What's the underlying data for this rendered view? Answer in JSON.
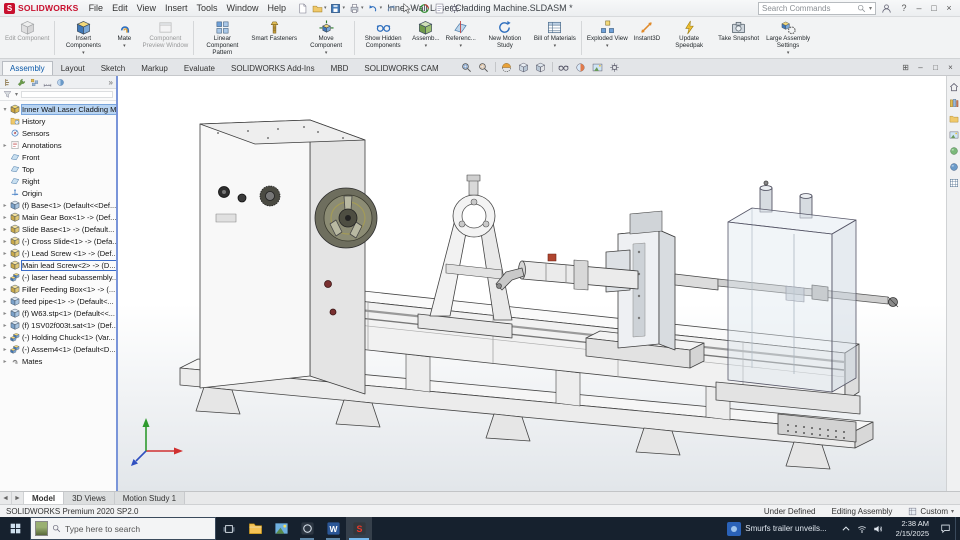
{
  "colors": {
    "brand": "#c8102e",
    "accent": "#2a6fc0",
    "taskbar-bg": "#16212e",
    "selection": "#b8d4f2",
    "splitter": "#7a95d9",
    "tab-active-text": "#0a58a8"
  },
  "titlebar": {
    "logo_glyph": "S",
    "brand": "SOLIDWORKS",
    "menus": [
      "File",
      "Edit",
      "View",
      "Insert",
      "Tools",
      "Window",
      "Help"
    ],
    "quick_access": [
      {
        "name": "new-document"
      },
      {
        "name": "open",
        "caret": true
      },
      {
        "name": "save",
        "caret": true
      },
      {
        "name": "print",
        "caret": true
      },
      {
        "name": "undo",
        "caret": true
      },
      {
        "name": "redo"
      },
      {
        "name": "select",
        "caret": true
      },
      {
        "name": "rebuild"
      },
      {
        "name": "file-properties"
      },
      {
        "name": "options",
        "caret": true
      }
    ],
    "title": "Inner Wall Laser Cladding Machine.SLDASM *",
    "search_placeholder": "Search Commands",
    "window_controls": [
      {
        "name": "help",
        "glyph": "?"
      },
      {
        "name": "minimize",
        "glyph": "–"
      },
      {
        "name": "maximize",
        "glyph": "□"
      },
      {
        "name": "close",
        "glyph": "×"
      }
    ]
  },
  "ribbon": {
    "separators_after": [
      0,
      3,
      6,
      11
    ],
    "buttons": [
      {
        "label": "Edit Component",
        "icon": "edit-component",
        "disabled": true
      },
      {
        "label": "Insert Components",
        "icon": "insert-components",
        "caret": true
      },
      {
        "label": "Mate",
        "icon": "mate",
        "caret": true
      },
      {
        "label": "Component Preview Window",
        "icon": "component-preview",
        "disabled": true
      },
      {
        "label": "Linear Component Pattern",
        "icon": "linear-pattern",
        "caret": true
      },
      {
        "label": "Smart Fasteners",
        "icon": "smart-fasteners"
      },
      {
        "label": "Move Component",
        "icon": "move-component",
        "caret": true
      },
      {
        "label": "Show Hidden Components",
        "icon": "show-hidden"
      },
      {
        "label": "Assemb...",
        "icon": "assembly-features",
        "caret": true
      },
      {
        "label": "Referenc...",
        "icon": "reference-geometry",
        "caret": true
      },
      {
        "label": "New Motion Study",
        "icon": "motion-study"
      },
      {
        "label": "Bill of Materials",
        "icon": "bom",
        "caret": true
      },
      {
        "label": "Exploded View",
        "icon": "exploded-view",
        "caret": true
      },
      {
        "label": "Instant3D",
        "icon": "instant3d"
      },
      {
        "label": "Update Speedpak",
        "icon": "speedpak"
      },
      {
        "label": "Take Snapshot",
        "icon": "take-snapshot"
      },
      {
        "label": "Large Assembly Settings",
        "icon": "large-assembly",
        "caret": true
      }
    ]
  },
  "command_tabs": {
    "items": [
      {
        "label": "Assembly",
        "active": true
      },
      {
        "label": "Layout"
      },
      {
        "label": "Sketch"
      },
      {
        "label": "Markup"
      },
      {
        "label": "Evaluate"
      },
      {
        "label": "SOLIDWORKS Add-Ins"
      },
      {
        "label": "MBD"
      },
      {
        "label": "SOLIDWORKS CAM"
      }
    ]
  },
  "headsup": {
    "icons": [
      "zoom-fit",
      "zoom-area",
      "section-view",
      "view-orientation",
      "display-style",
      "hide-show-items",
      "edit-appearance",
      "apply-scene",
      "view-settings"
    ]
  },
  "docwin_controls": [
    {
      "name": "new-window",
      "glyph": "⊞"
    },
    {
      "name": "minimize-doc",
      "glyph": "–"
    },
    {
      "name": "restore-doc",
      "glyph": "□"
    },
    {
      "name": "close-doc",
      "glyph": "×"
    }
  ],
  "panel_tabs": [
    "featuremanager-tab",
    "propertymanager-tab",
    "configurationmanager-tab",
    "dimxpert-tab",
    "displaymanager-tab"
  ],
  "panel_overflow_glyph": "»",
  "feature_tree": {
    "root": {
      "label": "Inner Wall Laser Cladding Mac",
      "icon": "assembly",
      "arrow": "▾",
      "selected": true
    },
    "items": [
      {
        "label": "History",
        "icon": "history",
        "arrow": false
      },
      {
        "label": "Sensors",
        "icon": "sensors",
        "arrow": false
      },
      {
        "label": "Annotations",
        "icon": "annotations",
        "arrow": true
      },
      {
        "label": "Front",
        "icon": "plane",
        "arrow": false
      },
      {
        "label": "Top",
        "icon": "plane",
        "arrow": false
      },
      {
        "label": "Right",
        "icon": "plane",
        "arrow": false
      },
      {
        "label": "Origin",
        "icon": "origin",
        "arr": false
      },
      {
        "label": "(f) Base<1> (Default<<Def...",
        "icon": "part",
        "arrow": true
      },
      {
        "label": "Main Gear Box<1> -> (Def...",
        "icon": "part-ext",
        "arrow": true
      },
      {
        "label": "Slide Base<1> -> (Default...",
        "icon": "part-ext",
        "arrow": true
      },
      {
        "label": "(-) Cross Slide<1> -> (Defa...",
        "icon": "part-ext",
        "arrow": true
      },
      {
        "label": "(-) Lead Screw <1> -> (Def...",
        "icon": "part-ext",
        "arrow": true
      },
      {
        "label": "Main lead Screw<2> -> (D...",
        "icon": "part-ext",
        "arrow": true,
        "boxed": true
      },
      {
        "label": "(-) laser head subassembly...",
        "icon": "subasm",
        "arrow": true
      },
      {
        "label": "Filler Feeding Box<1> -> (...",
        "icon": "part-ext",
        "arrow": true
      },
      {
        "label": "feed pipe<1> -> (Default<...",
        "icon": "part",
        "arrow": true
      },
      {
        "label": "(f) W63.stp<1> (Default<<...",
        "icon": "part",
        "arrow": true
      },
      {
        "label": "(f) 1SV02f003t.sat<1> (Def...",
        "icon": "part",
        "arrow": true
      },
      {
        "label": "(-) Holding Chuck<1> (Var...",
        "icon": "subasm",
        "arrow": true
      },
      {
        "label": "(-) Assem4<1> (Default<D...",
        "icon": "subasm",
        "arrow": true
      },
      {
        "label": "Mates",
        "icon": "mates",
        "arrow": true
      }
    ]
  },
  "task_pane": {
    "icons": [
      "home",
      "design-library",
      "file-explorer",
      "view-palette",
      "appearances",
      "scenes",
      "custom-properties"
    ]
  },
  "document_tabs": {
    "nav_glyphs": [
      "◄",
      "►"
    ],
    "items": [
      {
        "label": "Model",
        "active": true
      },
      {
        "label": "3D Views"
      },
      {
        "label": "Motion Study 1"
      }
    ]
  },
  "statusbar": {
    "left": "SOLIDWORKS Premium 2020 SP2.0",
    "status": "Under Defined",
    "mode": "Editing Assembly",
    "config": "Custom"
  },
  "taskbar": {
    "search_placeholder": "Type here to search",
    "apps": [
      {
        "name": "file-explorer"
      },
      {
        "name": "photos"
      },
      {
        "name": "media-app",
        "running": true
      },
      {
        "name": "word",
        "glyph": "W",
        "running": true
      },
      {
        "name": "solidworks",
        "glyph": "S",
        "running": true,
        "active": true
      }
    ],
    "news": "Smurfs trailer unveils...",
    "tray_icons": [
      "hidden-icons-chevron",
      "network",
      "volume"
    ],
    "time": "2:38 AM",
    "date": "2/15/2025"
  }
}
